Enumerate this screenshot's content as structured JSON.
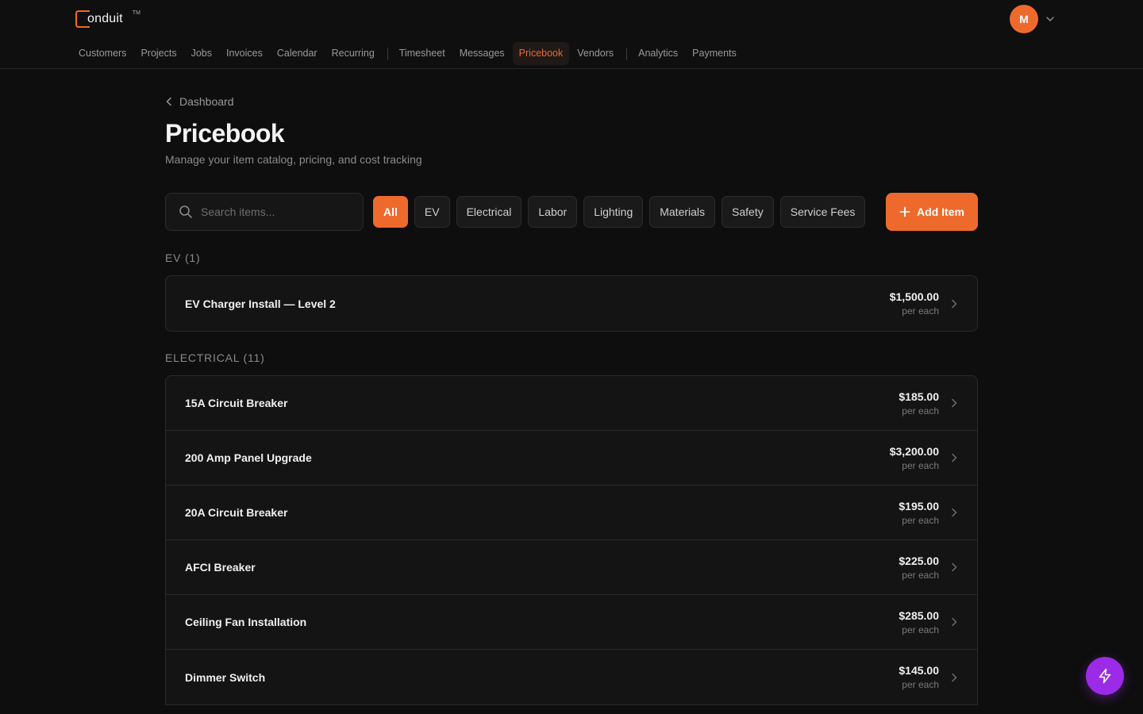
{
  "brand": {
    "name": "onduit",
    "tm": "TM",
    "accent": "#ee6a2c"
  },
  "user": {
    "initial": "M"
  },
  "nav": {
    "group1": [
      {
        "label": "Customers"
      },
      {
        "label": "Projects"
      },
      {
        "label": "Jobs"
      },
      {
        "label": "Invoices"
      },
      {
        "label": "Calendar"
      },
      {
        "label": "Recurring"
      }
    ],
    "group2": [
      {
        "label": "Timesheet"
      },
      {
        "label": "Messages"
      },
      {
        "label": "Pricebook",
        "active": true
      },
      {
        "label": "Vendors"
      }
    ],
    "group3": [
      {
        "label": "Analytics"
      },
      {
        "label": "Payments"
      }
    ]
  },
  "breadcrumb": {
    "label": "Dashboard"
  },
  "page": {
    "title": "Pricebook",
    "subtitle": "Manage your item catalog, pricing, and cost tracking"
  },
  "search": {
    "placeholder": "Search items...",
    "value": ""
  },
  "filters": [
    "All",
    "EV",
    "Electrical",
    "Labor",
    "Lighting",
    "Materials",
    "Safety",
    "Service Fees"
  ],
  "active_filter": "All",
  "add_button": {
    "label": "Add Item"
  },
  "sections": [
    {
      "label": "EV (1)",
      "items": [
        {
          "name": "EV Charger Install — Level 2",
          "price": "$1,500.00",
          "unit": "per each"
        }
      ]
    },
    {
      "label": "ELECTRICAL (11)",
      "items": [
        {
          "name": "15A Circuit Breaker",
          "price": "$185.00",
          "unit": "per each"
        },
        {
          "name": "200 Amp Panel Upgrade",
          "price": "$3,200.00",
          "unit": "per each"
        },
        {
          "name": "20A Circuit Breaker",
          "price": "$195.00",
          "unit": "per each"
        },
        {
          "name": "AFCI Breaker",
          "price": "$225.00",
          "unit": "per each"
        },
        {
          "name": "Ceiling Fan Installation",
          "price": "$285.00",
          "unit": "per each"
        },
        {
          "name": "Dimmer Switch",
          "price": "$145.00",
          "unit": "per each"
        }
      ]
    }
  ],
  "icons": {
    "search": "search-icon",
    "chevron_left": "chevron-left-icon",
    "chevron_right": "chevron-right-icon",
    "chevron_down": "chevron-down-icon",
    "plus": "plus-icon",
    "bolt": "lightning-bolt-icon"
  }
}
